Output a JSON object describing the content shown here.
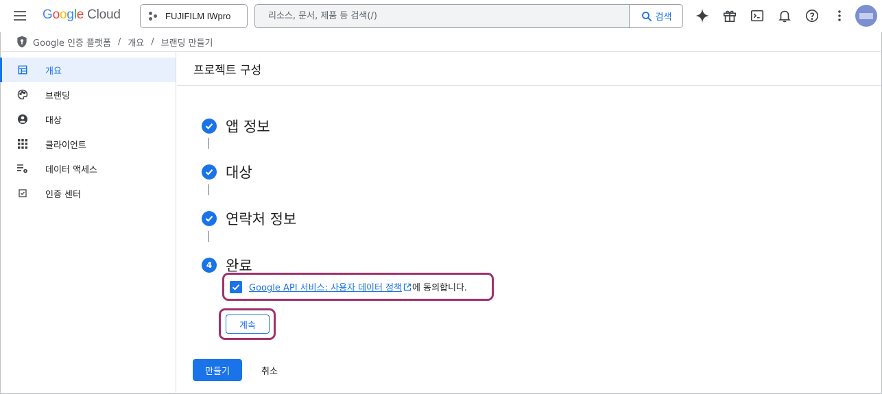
{
  "header": {
    "logo_google": "Google",
    "logo_cloud": "Cloud",
    "project_name": "FUJIFILM IWpro",
    "search_placeholder": "리소스, 문서, 제품 등 검색(/)",
    "search_button": "검색",
    "icons": [
      "menu-icon",
      "project-dots-icon",
      "search-icon",
      "gemini-spark-icon",
      "gift-icon",
      "cloud-shell-icon",
      "bell-icon",
      "help-icon",
      "more-vert-icon",
      "avatar"
    ]
  },
  "breadcrumb": {
    "items": [
      "Google 인증 플랫폼",
      "개요",
      "브랜딩 만들기"
    ],
    "separator": "/"
  },
  "sidebar": {
    "items": [
      {
        "label": "개요",
        "icon": "dashboard-icon",
        "active": true
      },
      {
        "label": "브랜딩",
        "icon": "palette-icon",
        "active": false
      },
      {
        "label": "대상",
        "icon": "account-circle-icon",
        "active": false
      },
      {
        "label": "클라이언트",
        "icon": "apps-grid-icon",
        "active": false
      },
      {
        "label": "데이터 액세스",
        "icon": "data-settings-icon",
        "active": false
      },
      {
        "label": "인증 센터",
        "icon": "verified-checkbox-icon",
        "active": false
      }
    ]
  },
  "main": {
    "title": "프로젝트 구성",
    "steps": [
      {
        "label": "앱 정보",
        "status": "complete"
      },
      {
        "label": "대상",
        "status": "complete"
      },
      {
        "label": "연락처 정보",
        "status": "complete"
      },
      {
        "label": "완료",
        "status": "current",
        "number": "4"
      }
    ],
    "consent": {
      "checked": true,
      "link_text": "Google API 서비스: 사용자 데이터 정책",
      "suffix": "에 동의합니다."
    },
    "continue_button": "계속",
    "create_button": "만들기",
    "cancel_button": "취소"
  },
  "colors": {
    "accent": "#1a73e8",
    "highlight_border": "#a0306c",
    "active_nav_bg": "#e8f0fe"
  }
}
